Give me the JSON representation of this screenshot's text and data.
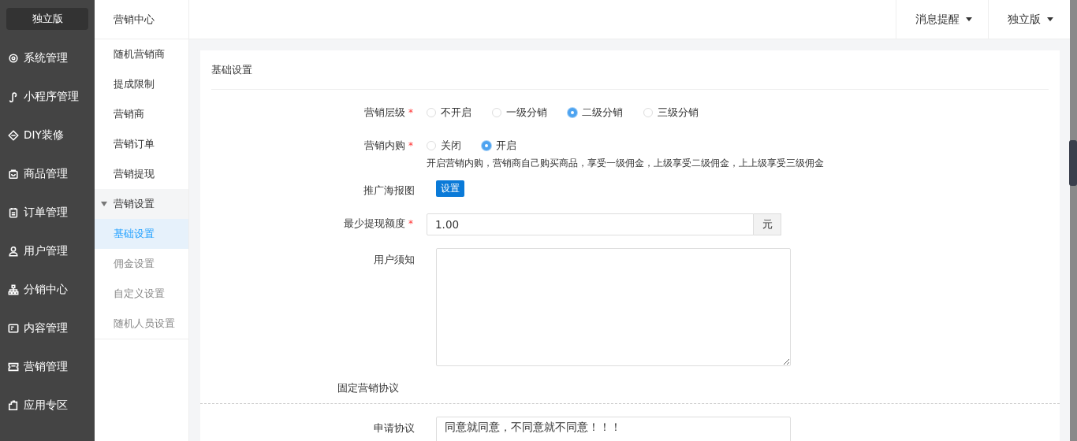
{
  "sidebar": {
    "edition": "独立版",
    "items": [
      {
        "label": "系统管理"
      },
      {
        "label": "小程序管理"
      },
      {
        "label": "DIY装修"
      },
      {
        "label": "商品管理"
      },
      {
        "label": "订单管理"
      },
      {
        "label": "用户管理"
      },
      {
        "label": "分销中心"
      },
      {
        "label": "内容管理"
      },
      {
        "label": "营销管理"
      },
      {
        "label": "应用专区"
      }
    ]
  },
  "subnav": {
    "title": "营销中心",
    "items": [
      {
        "label": "随机营销商",
        "kind": "link",
        "selected": false
      },
      {
        "label": "提成限制",
        "kind": "link",
        "selected": false
      },
      {
        "label": "营销商",
        "kind": "link",
        "selected": false
      },
      {
        "label": "营销订单",
        "kind": "link",
        "selected": false
      },
      {
        "label": "营销提现",
        "kind": "link",
        "selected": false
      },
      {
        "label": "营销设置",
        "kind": "group",
        "expanded": true,
        "children": [
          {
            "label": "基础设置",
            "selected": true
          },
          {
            "label": "佣金设置",
            "selected": false
          },
          {
            "label": "自定义设置",
            "selected": false
          },
          {
            "label": "随机人员设置",
            "selected": false
          }
        ]
      }
    ]
  },
  "topbar": {
    "menus": [
      "消息提醒",
      "独立版"
    ]
  },
  "panel": {
    "title": "基础设置",
    "fields": [
      {
        "kind": "radio",
        "label": "营销层级",
        "required_mark": "*",
        "options": [
          {
            "label": "不开启",
            "selected": false
          },
          {
            "label": "一级分销",
            "selected": false
          },
          {
            "label": "二级分销",
            "selected": true
          },
          {
            "label": "三级分销",
            "selected": false
          }
        ]
      },
      {
        "kind": "radio",
        "label": "营销内购",
        "required_mark": "*",
        "options": [
          {
            "label": "关闭",
            "selected": false
          },
          {
            "label": "开启",
            "selected": true
          }
        ],
        "hint": "开启营销内购，营销商自己购买商品，享受一级佣金，上级享受二级佣金，上上级享受三级佣金"
      },
      {
        "kind": "button",
        "label": "推广海报图",
        "button": "设置"
      },
      {
        "kind": "addon",
        "label": "最少提现额度",
        "required_mark": "*",
        "value": "1.00",
        "addon": "元"
      },
      {
        "kind": "textarea",
        "label": "用户须知"
      },
      {
        "kind": "section",
        "label": "固定营销协议"
      },
      {
        "kind": "textarea",
        "label": "申请协议",
        "value": "同意就同意，不同意就不同意！！！"
      }
    ]
  }
}
